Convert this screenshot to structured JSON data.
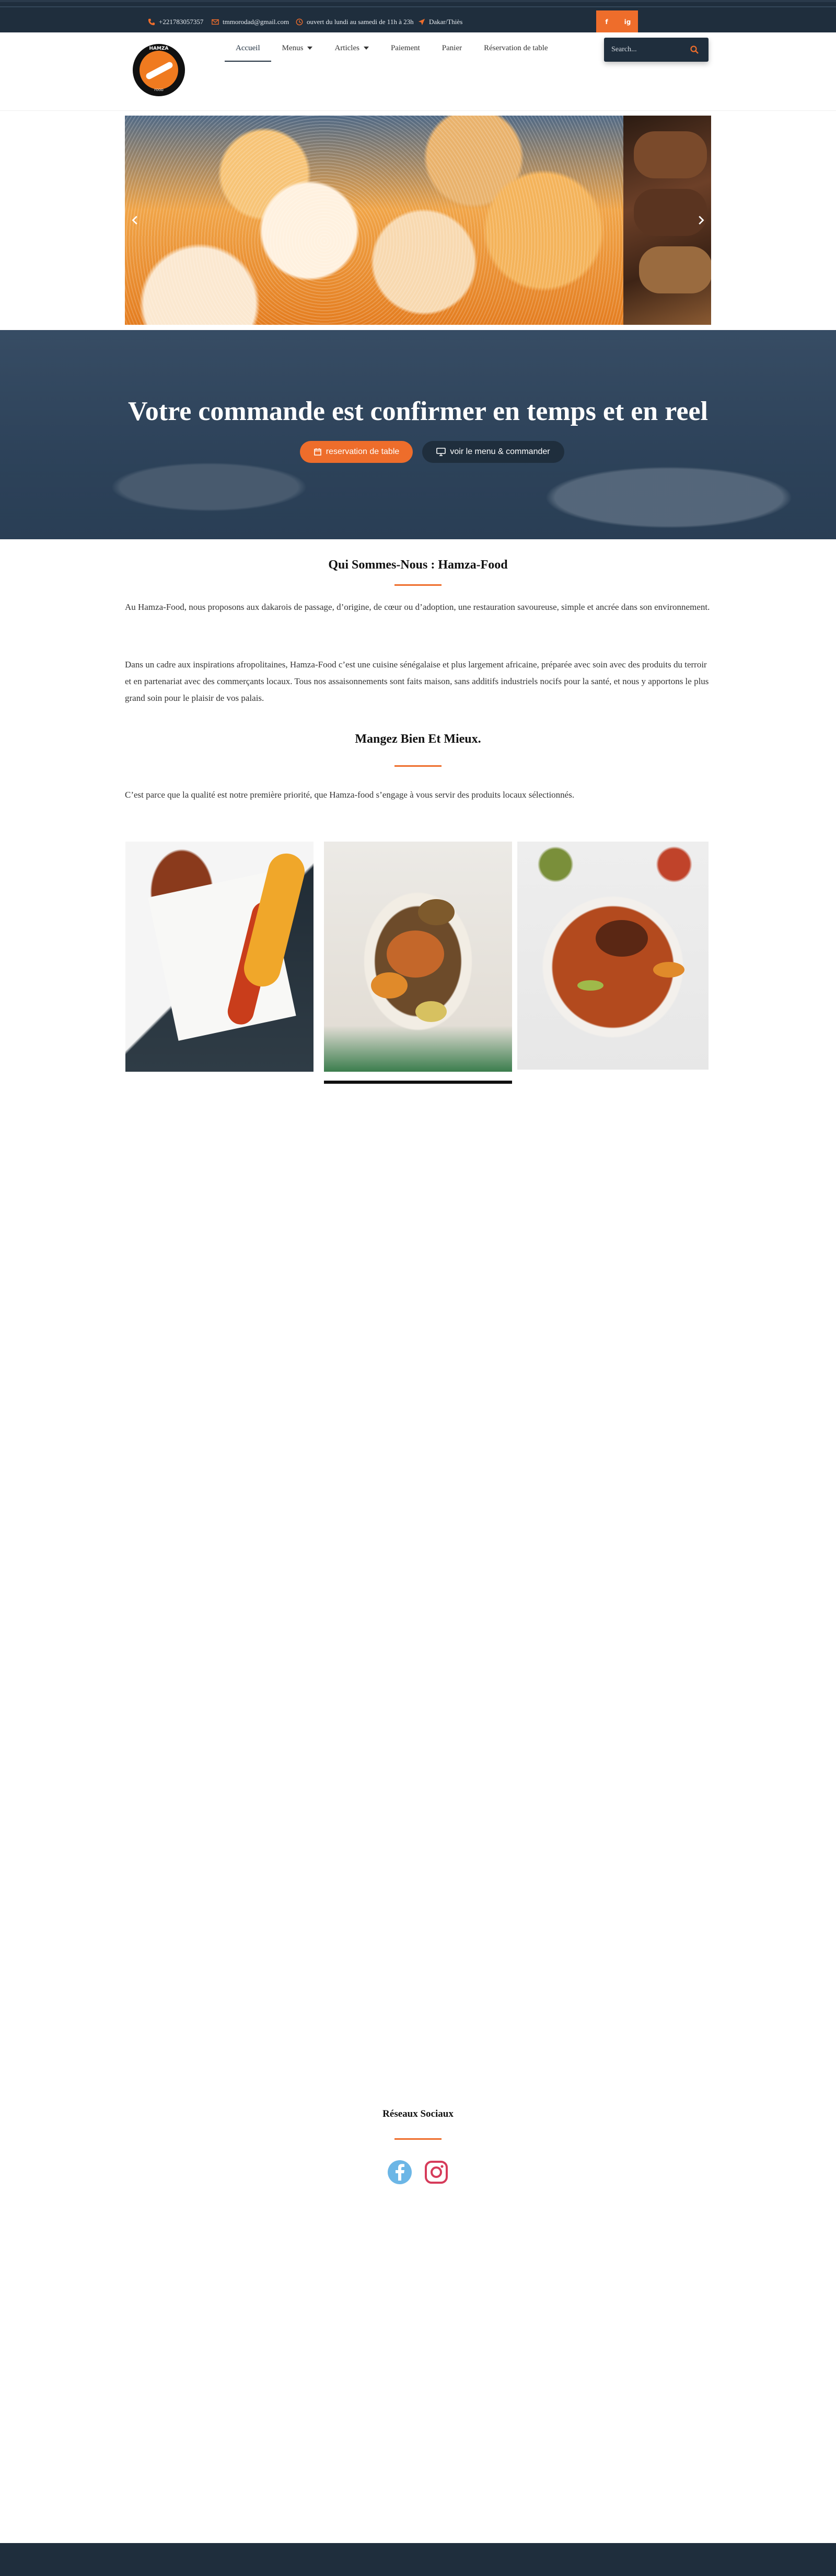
{
  "topbar": {
    "phone": "+221783057357",
    "email": "tmmorodad@gmail.com",
    "hours": "ouvert du lundi au samedi de 11h à 23h",
    "location": "Dakar/Thiès",
    "social": [
      "f",
      "ig"
    ]
  },
  "header": {
    "logo_text": "HAMZA",
    "logo_sub": "FOOD",
    "nav": [
      {
        "label": "Accueil",
        "active": true,
        "dropdown": false
      },
      {
        "label": "Menus",
        "active": false,
        "dropdown": true
      },
      {
        "label": "Articles",
        "active": false,
        "dropdown": true
      },
      {
        "label": "Paiement",
        "active": false,
        "dropdown": false
      },
      {
        "label": "Panier",
        "active": false,
        "dropdown": false
      },
      {
        "label": "Réservation de table",
        "active": false,
        "dropdown": false
      }
    ],
    "search_placeholder": "Search..."
  },
  "hero": {
    "title": "Votre commande est confirmer en temps et en reel",
    "btn_reservation": "reservation de table",
    "btn_menu": "voir le menu & commander"
  },
  "about": {
    "title": "Qui Sommes-Nous : Hamza-Food",
    "para1": "Au Hamza-Food, nous proposons aux dakarois de passage, d’origine, de cœur ou d’adoption, une restauration savoureuse, simple et ancrée dans son environnement.",
    "para2": "Dans un cadre aux inspirations afropolitaines, Hamza-Food c’est une cuisine sénégalaise et plus largement africaine, préparée avec soin avec des produits du terroir et en partenariat avec des commerçants locaux. Tous nos assaisonnements sont faits maison, sans additifs industriels nocifs pour la santé, et nous y apportons le plus grand soin pour le plaisir de vos palais."
  },
  "eat": {
    "title": "Mangez Bien Et Mieux.",
    "para": "C’est parce que la qualité est notre première priorité, que Hamza-food s’engage à vous servir des produits locaux sélectionnés."
  },
  "social": {
    "title": "Réseaux Sociaux",
    "icons": [
      "facebook-icon",
      "instagram-icon"
    ]
  },
  "colors": {
    "accent": "#ee6d2b",
    "dark": "#1f2e3d",
    "facebook": "#6cb6e6",
    "instagram": "#d63b5a"
  }
}
